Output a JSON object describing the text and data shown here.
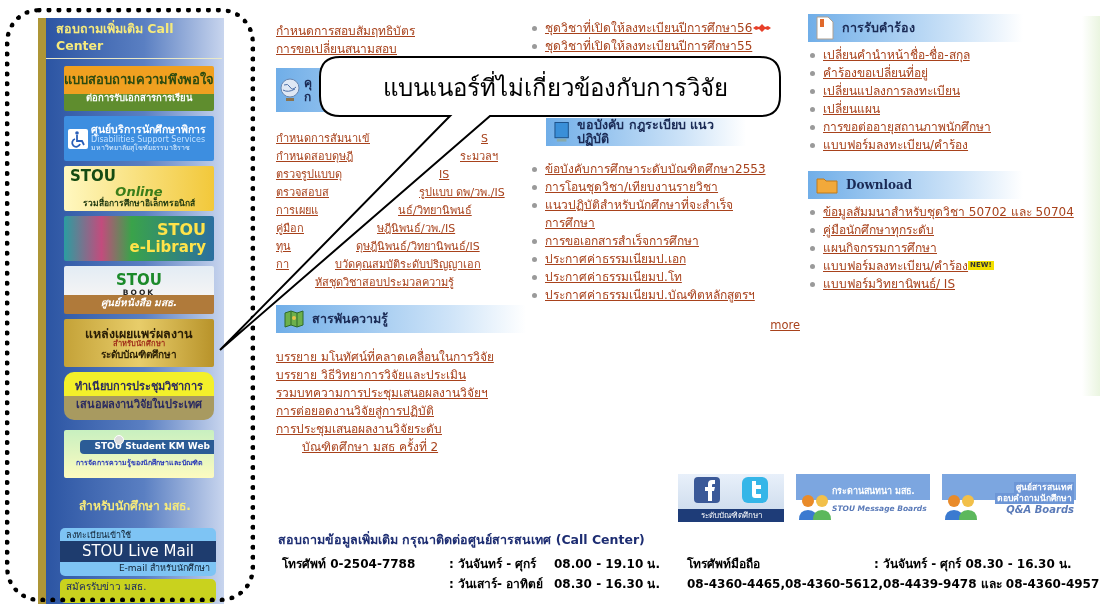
{
  "sidebar": {
    "title": "สอบถามเพิ่มเติม Call Center",
    "banners": [
      {
        "kind": "survey",
        "lines": [
          "แบบสอบถามความพึงพอใจ",
          "ต่อการรับเอกสารการเรียน"
        ]
      },
      {
        "kind": "disability",
        "lines": [
          "ศูนย์บริการนักศึกษาพิการ",
          "Disabilities Support Services",
          "มหาวิทยาลัยสุโขทัยธรรมาธิราช"
        ]
      },
      {
        "kind": "online",
        "lines": [
          "STOU",
          "Online",
          "รวมสื่อการศึกษาอิเล็กทรอนิกส์"
        ]
      },
      {
        "kind": "library",
        "lines": [
          "STOU",
          "e-Library"
        ]
      },
      {
        "kind": "book",
        "lines": [
          "STOU",
          "BOOK",
          "ศูนย์หนังสือ มสธ."
        ]
      },
      {
        "kind": "publish",
        "lines": [
          "แหล่งเผยแพร่ผลงาน",
          "สำหรับนักศึกษา",
          "ระดับบัณฑิตศึกษา"
        ]
      },
      {
        "kind": "conference",
        "lines": [
          "ทำเนียบการประชุมวิชาการ",
          "เสนอผลงานวิจัยในประเทศ"
        ]
      },
      {
        "kind": "km",
        "lines": [
          "STOU Student KM Web",
          "การจัดการความรู้ของนักศึกษาและบัณฑิต"
        ]
      }
    ],
    "student_title": "สำหรับนักศึกษา มสธ.",
    "student_banners": [
      {
        "kind": "mail",
        "lines": [
          "ลงทะเบียนเข้าใช้",
          "STOU Live Mail",
          "E-mail สำหรับนักศึกษา"
        ]
      },
      {
        "kind": "news",
        "lines": [
          "สมัครรับข่าว มสธ."
        ]
      }
    ]
  },
  "columns": [
    {
      "sections": [
        {
          "links": [
            {
              "text": "กำหนดการสอบสัมฤทธิบัตร"
            },
            {
              "text": "การขอเปลี่ยนสนามสอบ"
            }
          ]
        },
        {
          "heading_lines": [
            "คุ",
            "ก"
          ],
          "links": [
            {
              "text": "กำหนดการสัมนาเข้",
              "tail": "S"
            },
            {
              "text": "กำหนดสอบดุษฎี",
              "tail": "ระมวลฯ"
            },
            {
              "text": "ตรวจรูปแบบดุ",
              "tail": "IS"
            },
            {
              "text": "ตรวจสอบส",
              "tail": "รูปแบบ ดพ/วพ./IS"
            },
            {
              "text": "การเผยแ",
              "tail": "นธ์/วิทยานิพนธ์"
            },
            {
              "text": "คู่มือก",
              "tail": "ษฎีนิพนธ์/วพ./IS"
            },
            {
              "text": "ทุน",
              "tail": "ดุษฎีนิพนธ์/วิทยานิพนธ์/IS"
            },
            {
              "text": "กา",
              "tail": "บวัดคุณสมบัติระดับปริญญาเอก"
            },
            {
              "tail": "หัสชุดวิชาสอบประมวลความรู้"
            }
          ]
        },
        {
          "heading_lines": [
            "สารพันความรู้"
          ],
          "links": [
            {
              "text": "บรรยาย มโนทัศน์ที่คลาดเคลื่อนในการวิจัย"
            },
            {
              "text": "บรรยาย วิธีวิทยาการวิจัยและประเมิน"
            },
            {
              "text": "รวมบทความการประชุมเสนอผลงานวิจัยฯ"
            },
            {
              "text": "การต่อยอดงานวิจัยสู่การปฏิบัติ"
            },
            {
              "text": "การประชุมเสนอผลงานวิจัยระดับ",
              "continuation": "บัณฑิตศึกษา มสธ ครั้งที่ 2"
            }
          ]
        }
      ]
    },
    {
      "sections": [
        {
          "links": [
            {
              "text": "ชุดวิชาที่เปิดให้ลงทะเบียนปีการศึกษา56",
              "new_icon": true
            },
            {
              "text": "ชุดวิชาที่เปิดให้ลงทะเบียนปีการศึกษา55"
            }
          ]
        },
        {
          "heading_lines": [
            "ขอบังคับ กฎระเบียบ แนวปฏิบัติ"
          ],
          "links": [
            {
              "text": "ข้อบังคับการศึกษาระดับบัณฑิตศึกษา2553"
            },
            {
              "text": "การโอนชุดวิชา/เทียบงานรายวิชา"
            },
            {
              "text": "แนวปฏิบัติสำหรับนักศึกษาที่จะสำเร็จ",
              "continuation": "การศึกษา"
            },
            {
              "text": "การขอเอกสารสำเร็จการศึกษา"
            },
            {
              "text": "ประกาศค่าธรรมเนียมป.เอก"
            },
            {
              "text": "ประกาศค่าธรรมเนียมป.โท"
            },
            {
              "text": "ประกาศค่าธรรมเนียมป.บัณฑิตหลักสูตรฯ"
            }
          ],
          "more": "more"
        }
      ]
    },
    {
      "sections": [
        {
          "heading_lines": [
            "การรับคำร้อง"
          ],
          "links": [
            {
              "text": "เปลี่ยนคำนำหน้าชื่อ-ชื่อ-สกุล"
            },
            {
              "text": "คำร้องขอเปลี่ยนที่อยู่"
            },
            {
              "text": "เปลี่ยนแปลงการลงทะเบียน"
            },
            {
              "text": "เปลี่ยนแผน"
            },
            {
              "text": "การขอต่ออายุสถานภาพนักศึกษา"
            },
            {
              "text": "แบบฟอร์มลงทะเบียน/คำร้อง"
            }
          ]
        },
        {
          "heading_lines": [
            "Download"
          ],
          "links": [
            {
              "text": "ข้อมูลสัมมนาสำหรับชุดวิชา 50702 และ 50704"
            },
            {
              "text": "คู่มือนักศึกษาทุกระดับ"
            },
            {
              "text": "แผนกิจกรรมการศึกษา"
            },
            {
              "text": "แบบฟอร์มลงทะเบียน/คำร้อง",
              "badge": "NEW!"
            },
            {
              "text": "แบบฟอร์มวิทยานิพนธ์/ IS"
            }
          ]
        }
      ]
    }
  ],
  "boards": [
    {
      "kind": "social",
      "lines": [
        "ระดับบัณฑิตศึกษา"
      ]
    },
    {
      "kind": "board",
      "lines": [
        "กระดานสนทนา มสธ.",
        "STOU Message Boards"
      ]
    },
    {
      "kind": "qa",
      "lines": [
        "ศูนย์สารสนเทศ",
        "ตอบคำถามนักศึกษา",
        "Q&A Boards"
      ]
    }
  ],
  "contact": {
    "title": "สอบถามข้อมูลเพิ่มเติม กรุณาติดต่อศูนย์สารสนเทศ (Call Center)",
    "office_phone": "โทรศัพท์ 0-2504-7788",
    "weekday": ": วันจันทร์ - ศุกร์",
    "weekday_hours": "08.00 - 19.10 น.",
    "weekend": ": วันเสาร์- อาทิตย์",
    "weekend_hours": "08.30 - 16.30 น.",
    "mobile_label": "โทรศัพท์มือถือ",
    "mobile_hours": ": วันจันทร์ - ศุกร์  08.30 - 16.30 น.",
    "mobile_numbers": "08-4360-4465,08-4360-5612,08-4439-9478 และ 08-4360-4957"
  },
  "callout": {
    "text": "แบนเนอร์ที่ไม่เกี่ยวข้องกับการวิจัย"
  }
}
